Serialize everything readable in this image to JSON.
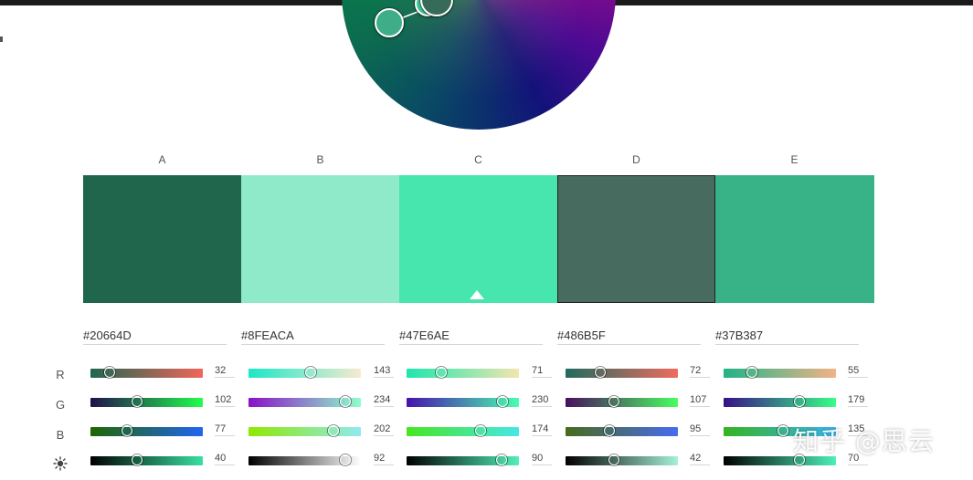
{
  "columns": [
    {
      "label": "A",
      "hex": "#20664D",
      "color": "#20664D",
      "r": 32,
      "g": 102,
      "b": 77,
      "brightness": 40,
      "r_grad": [
        "#206650",
        "#f0665a"
      ],
      "g_grad": [
        "#200f4d",
        "#20ff4d"
      ],
      "b_grad": [
        "#206600",
        "#2066f0"
      ],
      "l_grad": [
        "#000000",
        "#38e0a0"
      ]
    },
    {
      "label": "B",
      "hex": "#8FEACA",
      "color": "#8FEACA",
      "r": 143,
      "g": 234,
      "b": 202,
      "brightness": 92,
      "r_grad": [
        "#1ae8c8",
        "#f8ead0"
      ],
      "g_grad": [
        "#8a10c8",
        "#8fffca"
      ],
      "b_grad": [
        "#8fe800",
        "#8feaf0"
      ],
      "l_grad": [
        "#000000",
        "#ffffff"
      ]
    },
    {
      "label": "C",
      "hex": "#47E6AE",
      "color": "#47E6AE",
      "r": 71,
      "g": 230,
      "b": 174,
      "brightness": 90,
      "r_grad": [
        "#1ee6ae",
        "#f2e6ae"
      ],
      "g_grad": [
        "#4712ae",
        "#47ffae"
      ],
      "b_grad": [
        "#47e620",
        "#47e6e8"
      ],
      "l_grad": [
        "#000000",
        "#52f0b8"
      ]
    },
    {
      "label": "D",
      "hex": "#486B5F",
      "color": "#486B5F",
      "r": 72,
      "g": 107,
      "b": 95,
      "brightness": 42,
      "r_grad": [
        "#206b5f",
        "#f06b5f"
      ],
      "g_grad": [
        "#480f5f",
        "#48ff5f"
      ],
      "b_grad": [
        "#486b1a",
        "#486bf0"
      ],
      "l_grad": [
        "#000000",
        "#a6f0d8"
      ]
    },
    {
      "label": "E",
      "hex": "#37B387",
      "color": "#37B387",
      "r": 55,
      "g": 179,
      "b": 135,
      "brightness": 70,
      "r_grad": [
        "#20b387",
        "#f2b387"
      ],
      "g_grad": [
        "#371087",
        "#37ff87"
      ],
      "b_grad": [
        "#37b320",
        "#37b3f0"
      ],
      "l_grad": [
        "#000000",
        "#4ef0b8"
      ]
    }
  ],
  "row_labels": {
    "r": "R",
    "g": "G",
    "b": "B",
    "brightness_icon": "sun-icon"
  },
  "selected_index": 3,
  "base_index": 2,
  "watermark": "知乎 @思云"
}
